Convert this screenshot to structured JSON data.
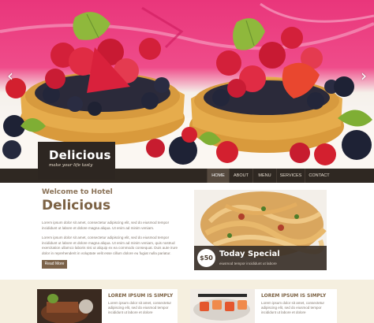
{
  "slider": {
    "prev_icon": "chevron-left-icon",
    "next_icon": "chevron-right-icon",
    "prev_glyph": "‹",
    "next_glyph": "›"
  },
  "logo": {
    "title": "Delicious",
    "tagline": "make your life tasty"
  },
  "nav": {
    "items": [
      {
        "label": "HOME",
        "active": true
      },
      {
        "label": "ABOUT",
        "active": false
      },
      {
        "label": "MENU",
        "active": false
      },
      {
        "label": "SERVICES",
        "active": false
      },
      {
        "label": "CONTACT",
        "active": false
      }
    ]
  },
  "welcome": {
    "subtitle": "Welcome to Hotel",
    "title": "Delicious",
    "paragraph1": "Lorem ipsum dolor sit amet, consectetur adipiscing elit, sed do eiusmod tempor incididunt ut labore et dolore magna aliqua. Ut enim ad minim veniam.",
    "paragraph2": "Lorem ipsum dolor sit amet, consectetur adipiscing elit, sed do eiusmod tempor incididunt ut labore et dolore magna aliqua. Ut enim ad minim veniam, quis nostrud exercitation ullamco laboris nisi ut aliquip ex ea commodo consequat. Duis aute irure dolor in reprehenderit in voluptate velit esse cillum dolore eu fugiat nulla pariatur.",
    "read_more": "Read More"
  },
  "special": {
    "price": "$50",
    "title": "Today Special",
    "subtitle": "eiusmod tempor incididunt ut labore"
  },
  "cards": [
    {
      "title": "LOREM IPSUM IS SIMPLY",
      "text": "Lorem ipsum dolor sit amet, consectetur adipiscing elit, sed do eiusmod tempor incididunt ut labore et dolore"
    },
    {
      "title": "LOREM IPSUM IS SIMPLY",
      "text": "Lorem ipsum dolor sit amet, consectetur adipiscing elit, sed do eiusmod tempor incididunt ut labore et dolore"
    }
  ],
  "colors": {
    "nav_bg": "#2f2822",
    "accent_brown": "#7c6244",
    "hero_pink": "#e9367b",
    "bottom_band": "#f5efdf"
  }
}
